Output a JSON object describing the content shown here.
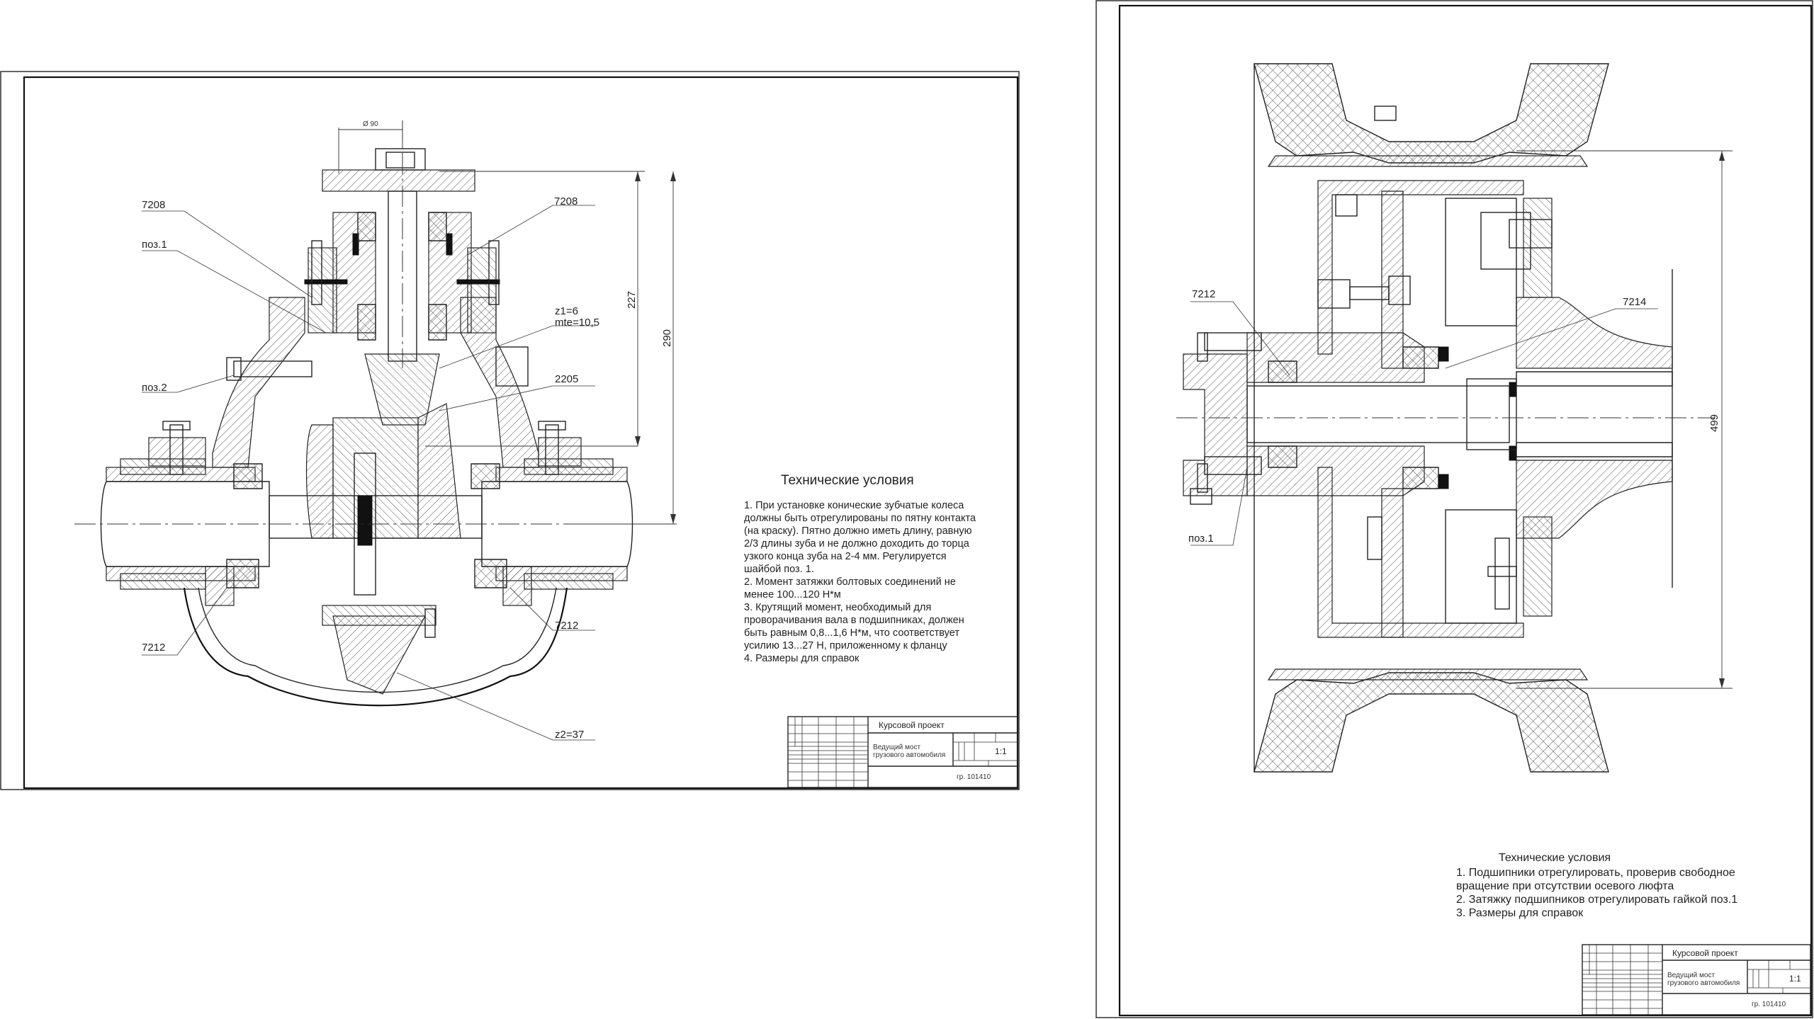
{
  "sheet1": {
    "labels": {
      "b7208_left": "7208",
      "b7208_right": "7208",
      "poz1": "поз.1",
      "poz2": "поз.2",
      "z1": "z1=6",
      "m": "mte=10,5",
      "b2205": "2205",
      "b7212_left": "7212",
      "b7212_right": "7212",
      "z2": "z2=37",
      "dim227": "227",
      "dim290": "290",
      "dim_small": "Ø 90"
    },
    "tech": {
      "title": "Технические условия",
      "lines": [
        "1. При установке конические зубчатые колеса",
        "должны быть отрегулированы по пятну контакта",
        "(на краску). Пятно должно иметь длину, равную",
        "2/3 длины зуба и не должно доходить до торца",
        "узкого конца зуба на 2-4 мм. Регулируется",
        "шайбой поз. 1.",
        "2. Момент затяжки болтовых соединений не",
        "менее 100...120 Н*м",
        "3. Крутящий момент, необходимый для",
        "проворачивания вала в подшипниках, должен",
        "быть равным 0,8...1,6 Н*м, что соответствует",
        "усилию 13...27 Н, приложенному к фланцу",
        "4. Размеры для справок"
      ]
    },
    "titleblock": {
      "project": "Курсовой проект",
      "name1": "Ведущий мост",
      "name2": "грузового автомобиля",
      "scale": "1:1",
      "group": "гр. 101410"
    }
  },
  "sheet2": {
    "labels": {
      "b7212": "7212",
      "b7214": "7214",
      "poz1": "поз.1",
      "dim499": "499"
    },
    "tech": {
      "title": "Технические условия",
      "lines": [
        "1. Подшипники отрегулировать, проверив свободное",
        "вращение при отсутствии осевого люфта",
        "2. Затяжку подшипников отрегулировать гайкой поз.1",
        "3. Размеры для справок"
      ]
    },
    "titleblock": {
      "project": "Курсовой проект",
      "name1": "Ведущий мост",
      "name2": "грузового автомобиля",
      "scale": "1:1",
      "group": "гр. 101410"
    }
  }
}
